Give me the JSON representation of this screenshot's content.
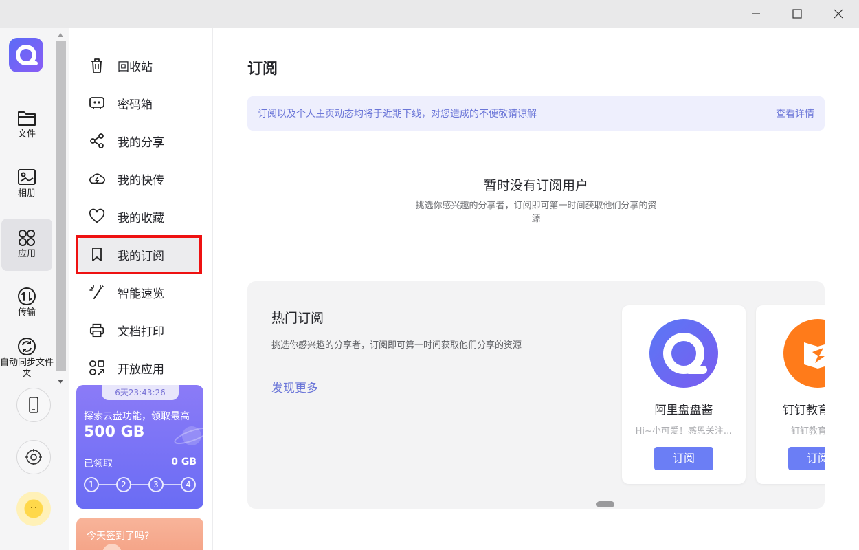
{
  "window": {
    "minimize_label": "minimize",
    "maximize_label": "maximize",
    "close_label": "close"
  },
  "rail": {
    "items": [
      {
        "label": "文件",
        "icon": "folder-icon"
      },
      {
        "label": "相册",
        "icon": "photo-album-icon"
      },
      {
        "label": "应用",
        "icon": "apps-grid-icon"
      },
      {
        "label": "传输",
        "icon": "transfer-icon"
      },
      {
        "label": "自动同步文件夹",
        "icon": "sync-icon"
      }
    ],
    "active_index": 2,
    "bottom_buttons": [
      "phone-icon",
      "settings-icon"
    ],
    "avatar_icon": "sun-avatar-icon"
  },
  "sidebar": {
    "items": [
      {
        "label": "回收站",
        "icon": "trash-icon"
      },
      {
        "label": "密码箱",
        "icon": "safe-box-icon"
      },
      {
        "label": "我的分享",
        "icon": "share-icon"
      },
      {
        "label": "我的快传",
        "icon": "cloud-upload-icon"
      },
      {
        "label": "我的收藏",
        "icon": "heart-icon"
      },
      {
        "label": "我的订阅",
        "icon": "bookmark-icon"
      },
      {
        "label": "智能速览",
        "icon": "magic-wand-icon"
      },
      {
        "label": "文档打印",
        "icon": "printer-icon"
      },
      {
        "label": "开放应用",
        "icon": "open-apps-icon"
      }
    ],
    "active_index": 5
  },
  "promo": {
    "timer": "6天23:43:26",
    "line1": "探索云盘功能，领取最高",
    "amount": "500 GB",
    "received_label": "已领取",
    "received_value": "0 GB",
    "steps": [
      "1",
      "2",
      "3",
      "4"
    ]
  },
  "checkin": {
    "label": "今天签到了吗?"
  },
  "main": {
    "title": "订阅",
    "notice": {
      "message": "订阅以及个人主页动态均将于近期下线，对您造成的不便敬请谅解",
      "link": "查看详情"
    },
    "empty": {
      "title": "暂时没有订阅用户",
      "description": "挑选你感兴趣的分享者，订阅即可第一时间获取他们分享的资源"
    },
    "hot": {
      "title": "热门订阅",
      "description": "挑选你感兴趣的分享者，订阅即可第一时间获取他们分享的资源",
      "more_link": "发现更多",
      "cards": [
        {
          "name": "阿里盘盘酱",
          "bio": "Hi~小可爱！感恩关注...",
          "button": "订阅",
          "avatar_icon": "aliyun-drive-avatar-icon"
        },
        {
          "name": "钉钉教育官方",
          "bio": "钉钉教育官方",
          "button": "订阅",
          "avatar_icon": "dingtalk-education-avatar-icon"
        }
      ]
    }
  },
  "colors": {
    "accent": "#6b7ef5",
    "highlight_border": "#ee1111",
    "notice_bg": "#eeeffd"
  }
}
